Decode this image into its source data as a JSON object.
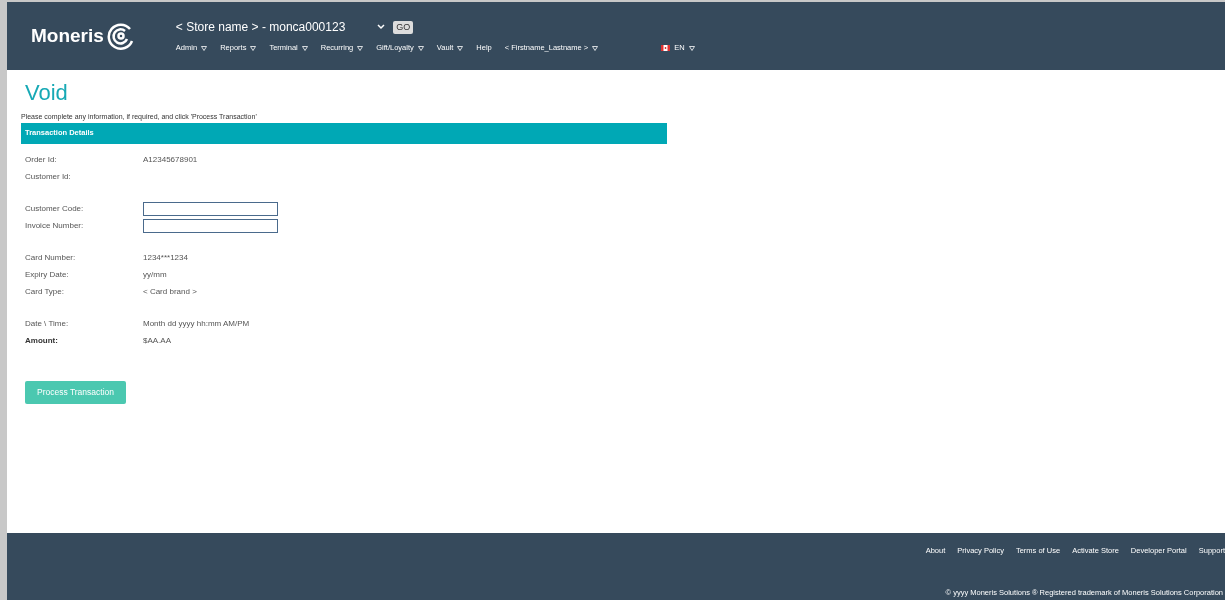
{
  "header": {
    "logo": "Moneris",
    "store_select": "< Store name > - monca000123",
    "go_button": "GO",
    "menu": [
      {
        "label": "Admin",
        "dropdown": true
      },
      {
        "label": "Reports",
        "dropdown": true
      },
      {
        "label": "Terminal",
        "dropdown": true
      },
      {
        "label": "Recurring",
        "dropdown": true
      },
      {
        "label": "Gift/Loyalty",
        "dropdown": true
      },
      {
        "label": "Vault",
        "dropdown": true
      },
      {
        "label": "Help",
        "dropdown": false
      },
      {
        "label": "< Firstname_Lastname >",
        "dropdown": true
      }
    ],
    "language": {
      "label": "EN",
      "dropdown": true
    }
  },
  "page": {
    "title": "Void",
    "instructions": "Please complete any information, if required, and click 'Process Transaction'",
    "section_title": "Transaction Details",
    "groups": [
      [
        {
          "kind": "text",
          "label": "Order Id:",
          "value": "A12345678901",
          "bold": false
        },
        {
          "kind": "text",
          "label": "Customer Id:",
          "bold": false
        }
      ],
      [
        {
          "kind": "input",
          "label": "Customer Code:",
          "bold": false
        },
        {
          "kind": "input",
          "label": "Invoice Number:",
          "bold": false
        }
      ],
      [
        {
          "kind": "text",
          "label": "Card Number:",
          "value": "1234***1234",
          "bold": false
        },
        {
          "kind": "text",
          "label": "Expiry Date:",
          "value": "yy/mm",
          "bold": false
        },
        {
          "kind": "text",
          "label": "Card Type:",
          "value": "< Card brand >",
          "bold": false
        }
      ],
      [
        {
          "kind": "text",
          "label": "Date \\ Time:",
          "value": "Month dd yyyy hh:mm AM/PM",
          "bold": false
        },
        {
          "kind": "text",
          "label": "Amount:",
          "value": "$AA.AA",
          "bold": true
        }
      ]
    ],
    "submit_button": "Process Transaction"
  },
  "footer": {
    "links": [
      "About",
      "Privacy Policy",
      "Terms of Use",
      "Activate Store",
      "Developer Portal",
      "Support"
    ],
    "copyright": "© yyyy Moneris Solutions ® Registered trademark of Moneris Solutions Corporation"
  }
}
